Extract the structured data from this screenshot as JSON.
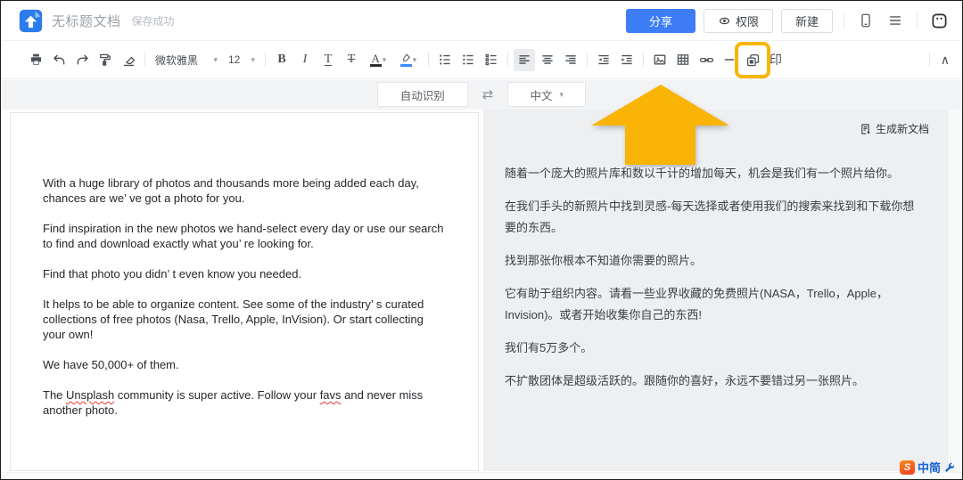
{
  "topbar": {
    "title": "无标题文档",
    "save_status": "保存成功",
    "share_label": "分享",
    "permission_label": "权限",
    "new_label": "新建"
  },
  "toolbar": {
    "font_family_value": "微软雅黑",
    "font_size_value": "12",
    "bold_glyph": "B",
    "italic_glyph": "I",
    "underline_glyph": "T",
    "strikethrough_glyph": "T",
    "font_color_glyph": "A",
    "stamp_label": "印",
    "caret_glyph": "▾",
    "collapse_glyph": "∧"
  },
  "translate_bar": {
    "source_language": "自动识别",
    "swap_glyph": "⇄",
    "target_language": "中文",
    "caret_glyph": "▾"
  },
  "left_doc": {
    "paragraphs": [
      [
        {
          "t": "With a huge library of photos and thousands more being added each day, chances are we’ ve got a photo for you."
        }
      ],
      [
        {
          "t": "Find inspiration in the new photos we hand-select every day or use our search to find and download exactly what you’ re looking for."
        }
      ],
      [
        {
          "t": "Find that photo you didn’ t even know you needed."
        }
      ],
      [
        {
          "t": "It helps to be able to organize content. See some of the industry’ s curated collections of free photos (Nasa, Trello, Apple, InVision). Or start collecting your own!"
        }
      ],
      [
        {
          "t": "We have 50,000+ of them."
        }
      ],
      [
        {
          "t": "The "
        },
        {
          "t": "Unsplash",
          "u": true
        },
        {
          "t": " community is super active. Follow your "
        },
        {
          "t": "favs",
          "u": true
        },
        {
          "t": " and never miss another photo."
        }
      ]
    ]
  },
  "right_doc": {
    "generate_new_doc_label": "生成新文档",
    "paragraphs": [
      "随着一个庞大的照片库和数以千计的增加每天，机会是我们有一个照片给你。",
      "在我们手头的新照片中找到灵感-每天选择或者使用我们的搜索来找到和下载你想要的东西。",
      "找到那张你根本不知道你需要的照片。",
      "它有助于组织内容。请看一些业界收藏的免费照片(NASA，Trello，Apple，Invision)。或者开始收集你自己的东西!",
      "我们有5万多个。",
      "不扩散团体是超级活跃的。跟随你的喜好，永远不要错过另一张照片。"
    ]
  },
  "watermark": {
    "badge_letter": "S",
    "brand_text": "中简"
  },
  "colors": {
    "accent_blue": "#3D7EF7",
    "highlight_yellow": "#F8B500",
    "arrow_yellow": "#F9B405",
    "spellcheck_red": "#E03A2F"
  }
}
